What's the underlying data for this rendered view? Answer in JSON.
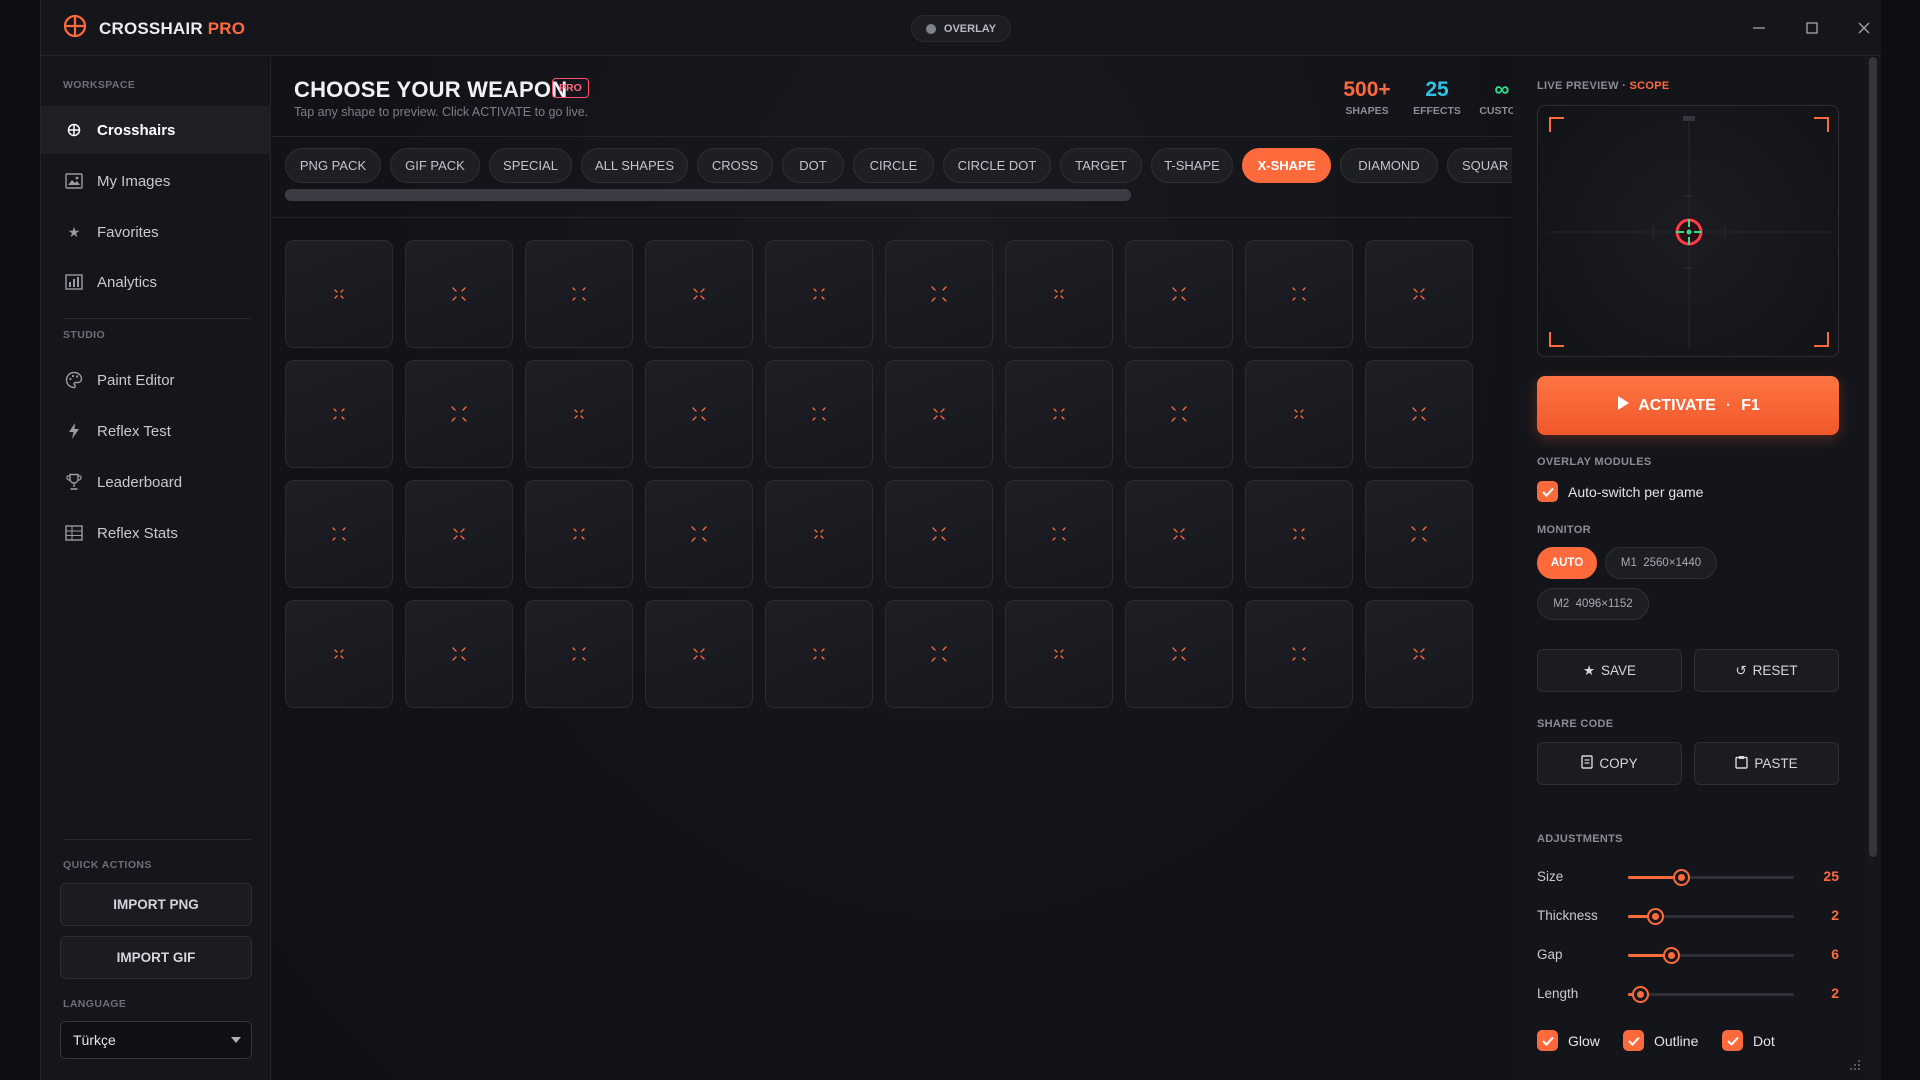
{
  "app": {
    "title_main": "CROSSHAIR ",
    "title_accent": "PRO",
    "overlay_label": "OVERLAY"
  },
  "sidebar": {
    "workspace_label": "WORKSPACE",
    "workspace_items": [
      {
        "label": "Crosshairs",
        "icon": "crosshair-icon",
        "active": true
      },
      {
        "label": "My Images",
        "icon": "image-icon"
      },
      {
        "label": "Favorites",
        "icon": "star-icon"
      },
      {
        "label": "Analytics",
        "icon": "bar-chart-icon"
      }
    ],
    "studio_label": "STUDIO",
    "studio_items": [
      {
        "label": "Paint Editor",
        "icon": "palette-icon"
      },
      {
        "label": "Reflex Test",
        "icon": "lightning-icon"
      },
      {
        "label": "Leaderboard",
        "icon": "trophy-icon"
      },
      {
        "label": "Reflex Stats",
        "icon": "stats-icon"
      }
    ],
    "quick_actions_label": "QUICK ACTIONS",
    "import_png": "IMPORT PNG",
    "import_gif": "IMPORT GIF",
    "language_label": "LANGUAGE",
    "language_value": "Türkçe"
  },
  "main": {
    "title": "CHOOSE YOUR WEAPON",
    "pro_badge": "PRO",
    "subtitle": "Tap any shape to preview. Click ACTIVATE to go live.",
    "stats": [
      {
        "value": "500+",
        "label": "SHAPES",
        "color": "#ff6a3d"
      },
      {
        "value": "25",
        "label": "EFFECTS",
        "color": "#2ec4e6"
      },
      {
        "value": "∞",
        "label": "CUSTOM",
        "color": "#2ee08a"
      }
    ],
    "tabs": [
      "PNG PACK",
      "GIF PACK",
      "SPECIAL",
      "ALL SHAPES",
      "CROSS",
      "DOT",
      "CIRCLE",
      "CIRCLE DOT",
      "TARGET",
      "T-SHAPE",
      "X-SHAPE",
      "DIAMOND",
      "SQUAR"
    ],
    "active_tab": "X-SHAPE",
    "grid": {
      "rows": 4,
      "cols": 10
    }
  },
  "panel": {
    "live_preview_label": "LIVE PREVIEW · ",
    "live_preview_mode": "SCOPE",
    "activate_label": "ACTIVATE",
    "activate_hotkey": "F1",
    "overlay_modules_label": "OVERLAY MODULES",
    "auto_switch_label": "Auto-switch per game",
    "monitor_label": "MONITOR",
    "monitors": [
      {
        "label": "AUTO",
        "active": true
      },
      {
        "label": "M1  2560×1440"
      },
      {
        "label": "M2  4096×1152"
      }
    ],
    "save_label": "SAVE",
    "reset_label": "RESET",
    "share_code_label": "SHARE CODE",
    "copy_label": "COPY",
    "paste_label": "PASTE",
    "adjustments_label": "ADJUSTMENTS",
    "adjustments": [
      {
        "label": "Size",
        "value": "25",
        "fraction": 0.32
      },
      {
        "label": "Thickness",
        "value": "2",
        "fraction": 0.16
      },
      {
        "label": "Gap",
        "value": "6",
        "fraction": 0.26
      },
      {
        "label": "Length",
        "value": "2",
        "fraction": 0.07
      }
    ],
    "toggles": [
      {
        "label": "Glow",
        "checked": true
      },
      {
        "label": "Outline",
        "checked": true
      },
      {
        "label": "Dot",
        "checked": true
      }
    ]
  },
  "colors": {
    "accent": "#ff6a3d",
    "cyan": "#2ec4e6",
    "green": "#2ee08a"
  }
}
